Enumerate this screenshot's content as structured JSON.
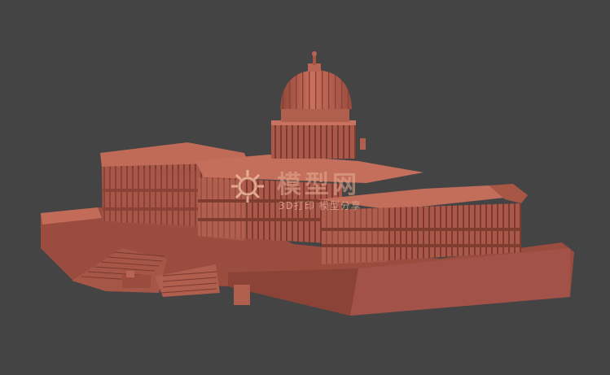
{
  "viewport": {
    "background_color": "#444444",
    "model_color": "#b35e4e"
  },
  "watermark": {
    "title": "模型网",
    "subtitle": "3D打印  模型分享",
    "icon": "gear-logo-icon"
  }
}
